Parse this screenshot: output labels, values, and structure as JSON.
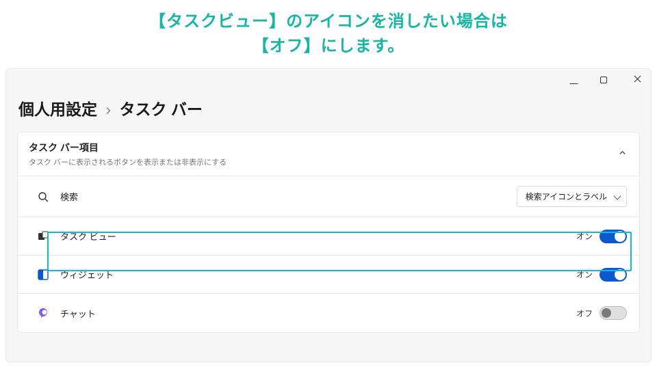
{
  "annotation": {
    "line1": "【タスクビュー】のアイコンを消したい場合は",
    "line2": "【オフ】にします。"
  },
  "breadcrumb": {
    "root": "個人用設定",
    "sep": "›",
    "page": "タスク バー"
  },
  "panel": {
    "title": "タスク バー項目",
    "subtitle": "タスク バーに表示されるボタンを表示または非表示にする"
  },
  "rows": {
    "search": {
      "label": "検索",
      "dropdown": "検索アイコンとラベル"
    },
    "taskview": {
      "label": "タスク ビュー",
      "state": "オン"
    },
    "widgets": {
      "label": "ウィジェット",
      "state": "オン"
    },
    "chat": {
      "label": "チャット",
      "state": "オフ"
    }
  }
}
